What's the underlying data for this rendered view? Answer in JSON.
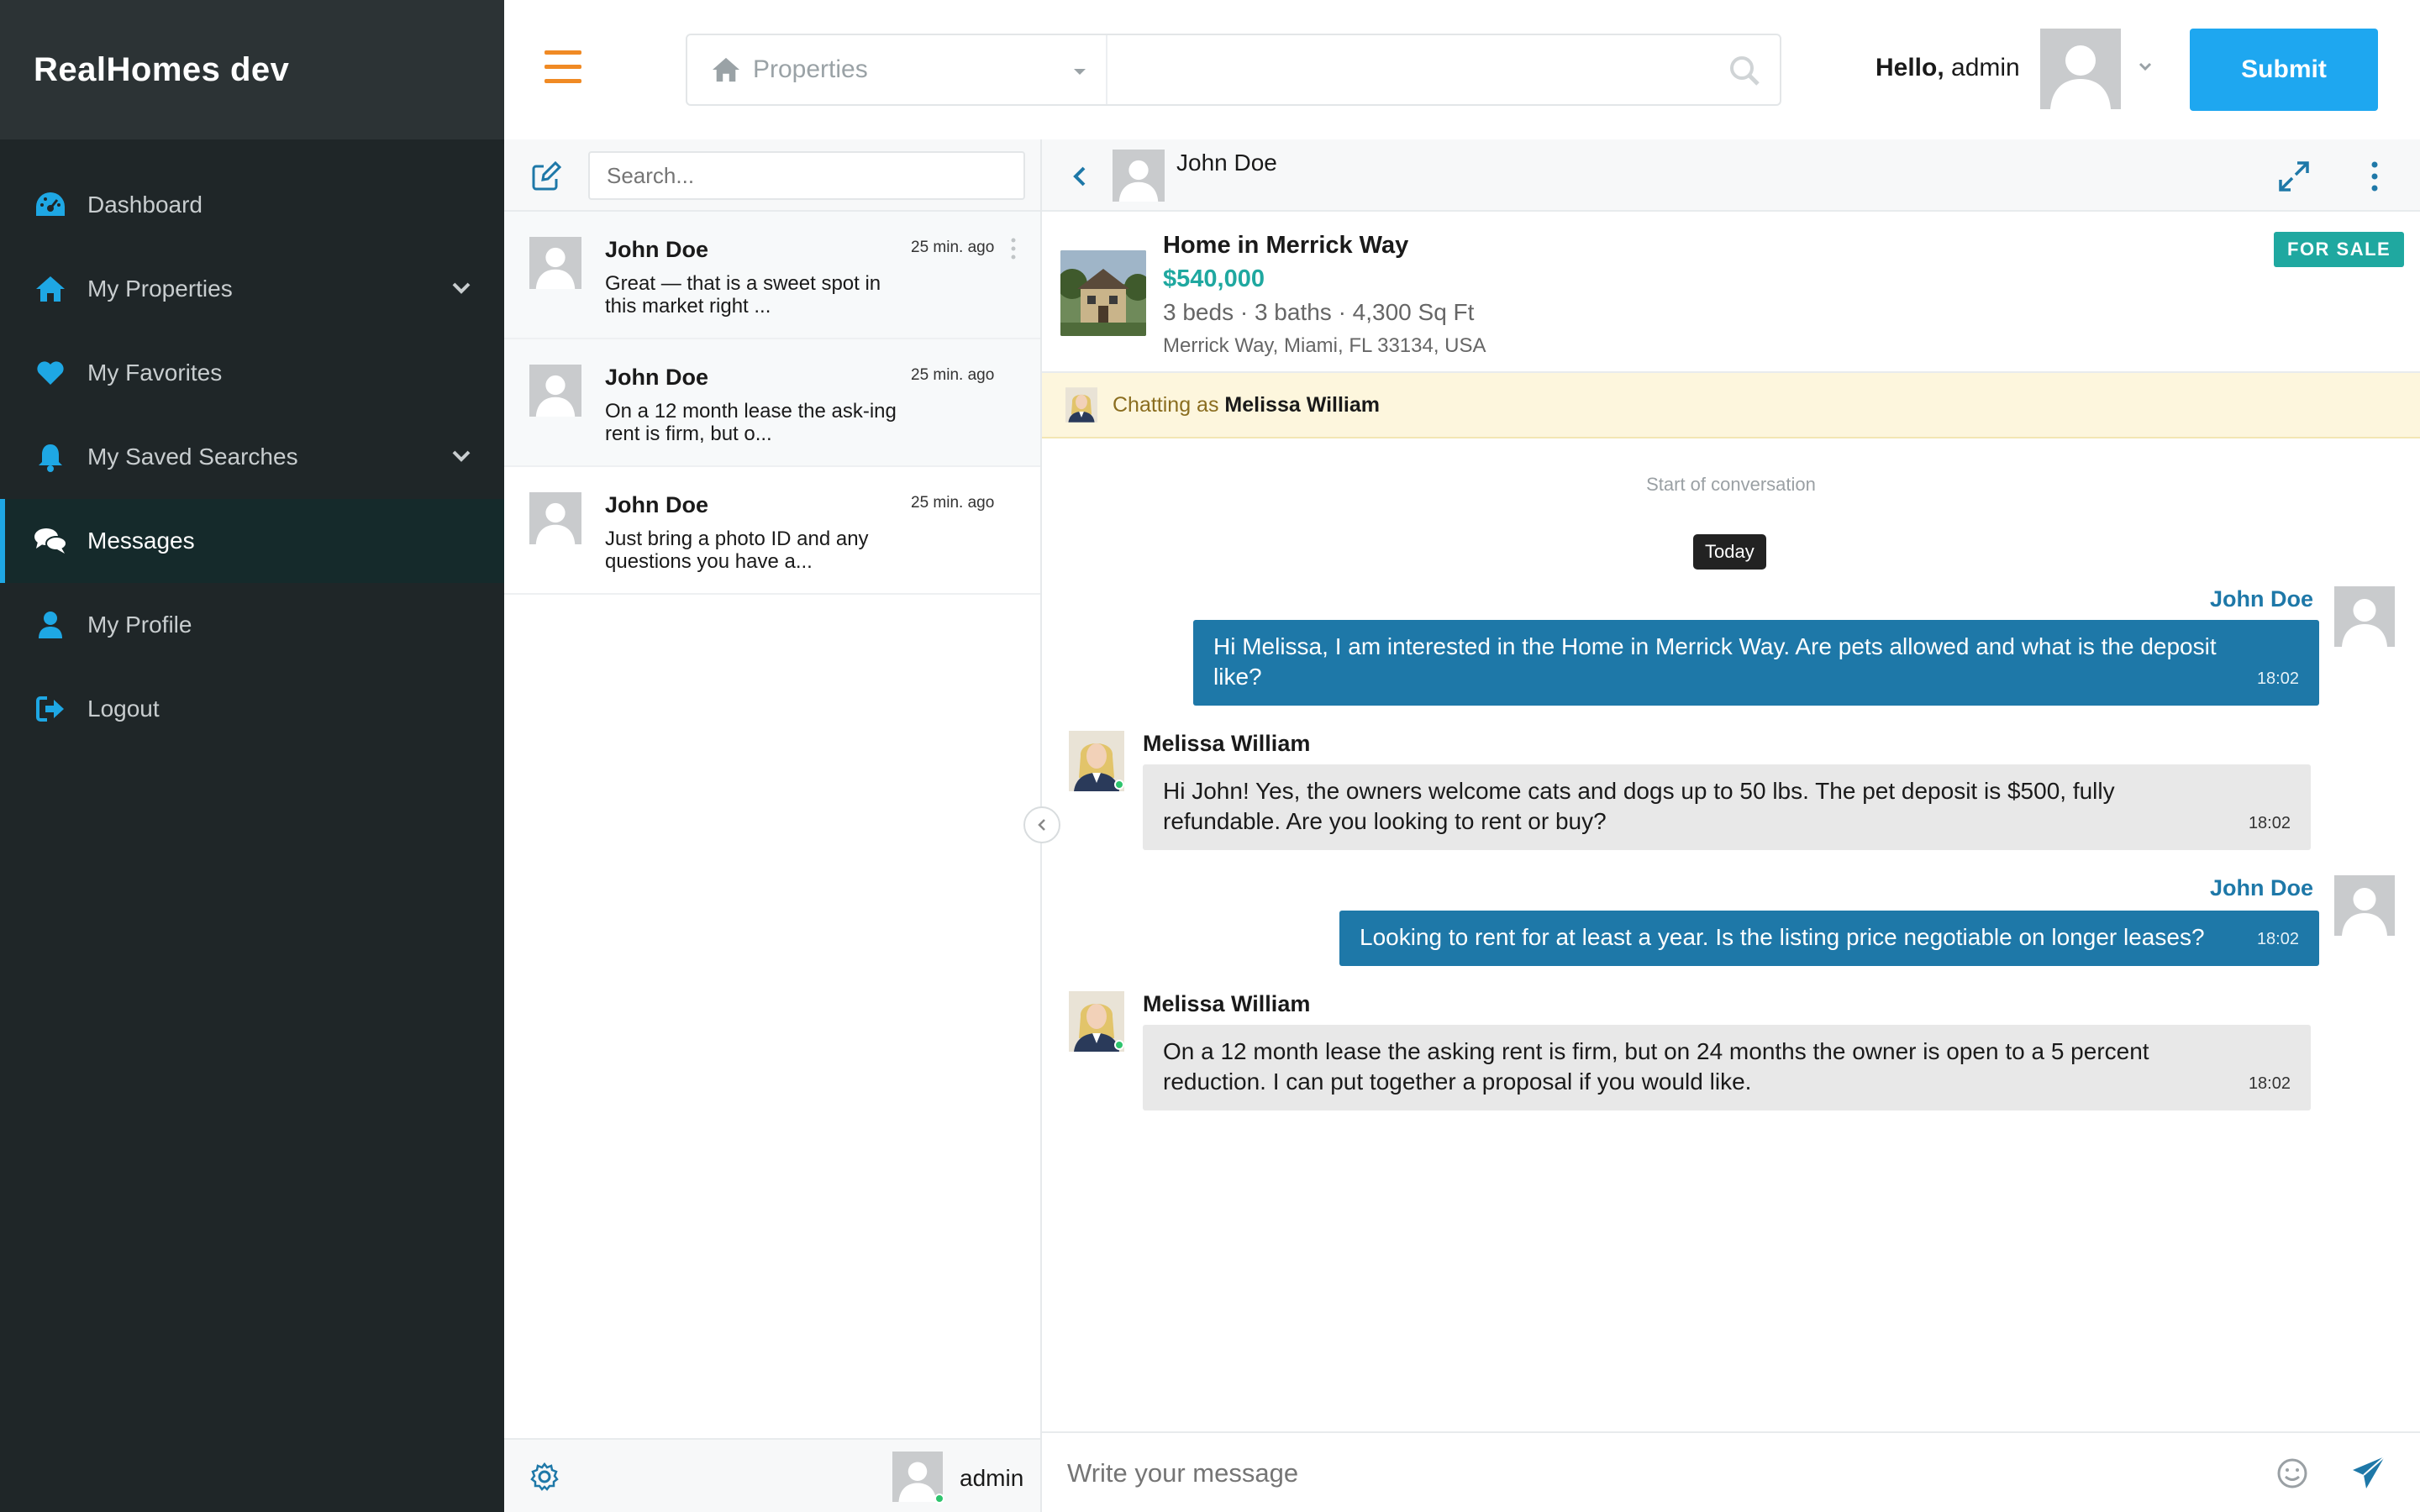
{
  "app": {
    "brand": "RealHomes dev"
  },
  "sidebar": {
    "items": [
      {
        "label": "Dashboard",
        "icon": "dashboard-icon",
        "has_children": false,
        "active": false
      },
      {
        "label": "My Properties",
        "icon": "home-icon",
        "has_children": true,
        "active": false
      },
      {
        "label": "My Favorites",
        "icon": "heart-icon",
        "has_children": false,
        "active": false
      },
      {
        "label": "My Saved Searches",
        "icon": "bell-icon",
        "has_children": true,
        "active": false
      },
      {
        "label": "Messages",
        "icon": "chat-icon",
        "has_children": false,
        "active": true
      },
      {
        "label": "My Profile",
        "icon": "user-icon",
        "has_children": false,
        "active": false
      },
      {
        "label": "Logout",
        "icon": "logout-icon",
        "has_children": false,
        "active": false
      }
    ]
  },
  "header": {
    "search_type": "Properties",
    "search_value": "",
    "hello_prefix": "Hello,",
    "username": "admin",
    "submit_label": "Submit"
  },
  "conversations": {
    "search_placeholder": "Search...",
    "items": [
      {
        "name": "John Doe",
        "time": "25 min. ago",
        "preview": "Great — that is a sweet spot in this market right ..."
      },
      {
        "name": "John Doe",
        "time": "25 min. ago",
        "preview": "On a 12 month lease the ask-ing rent is firm, but o..."
      },
      {
        "name": "John Doe",
        "time": "25 min. ago",
        "preview": "Just bring a photo ID and any questions you have a..."
      }
    ],
    "footer_user": "admin"
  },
  "chat": {
    "contact": "John Doe",
    "listing": {
      "title": "Home in Merrick Way",
      "price": "$540,000",
      "specs": "3 beds · 3 baths · 4,300 Sq Ft",
      "address": "Merrick Way, Miami, FL 33134, USA",
      "badge": "FOR SALE"
    },
    "chatting_as_prefix": "Chatting as",
    "chatting_as_name": "Melissa William",
    "start_label": "Start of conversation",
    "day_label": "Today",
    "messages": [
      {
        "sender": "John Doe",
        "direction": "out",
        "text": "Hi Melissa, I am interested in the Home in Merrick Way. Are pets allowed and what is the deposit like?",
        "time": "18:02"
      },
      {
        "sender": "Melissa William",
        "direction": "in",
        "text": "Hi John! Yes, the owners welcome cats and dogs up to 50 lbs. The pet deposit is $500, fully refundable. Are you looking to rent or buy?",
        "time": "18:02"
      },
      {
        "sender": "John Doe",
        "direction": "out",
        "text": "Looking to rent for at least a year. Is the listing price negotiable on longer leases?",
        "time": "18:02"
      },
      {
        "sender": "Melissa William",
        "direction": "in",
        "text": "On a 12 month lease the asking rent is firm, but on 24 months the owner is open to a 5 percent reduction. I can put together a proposal if you would like.",
        "time": "18:02"
      }
    ],
    "composer_placeholder": "Write your message"
  },
  "colors": {
    "sidebar_bg": "#1f2628",
    "accent_blue": "#1ea7f0",
    "outgoing_bubble": "#1e78a8",
    "incoming_bubble": "#e8e8e8",
    "price_teal": "#1fa8a0",
    "hamburger_orange": "#f08a24"
  }
}
